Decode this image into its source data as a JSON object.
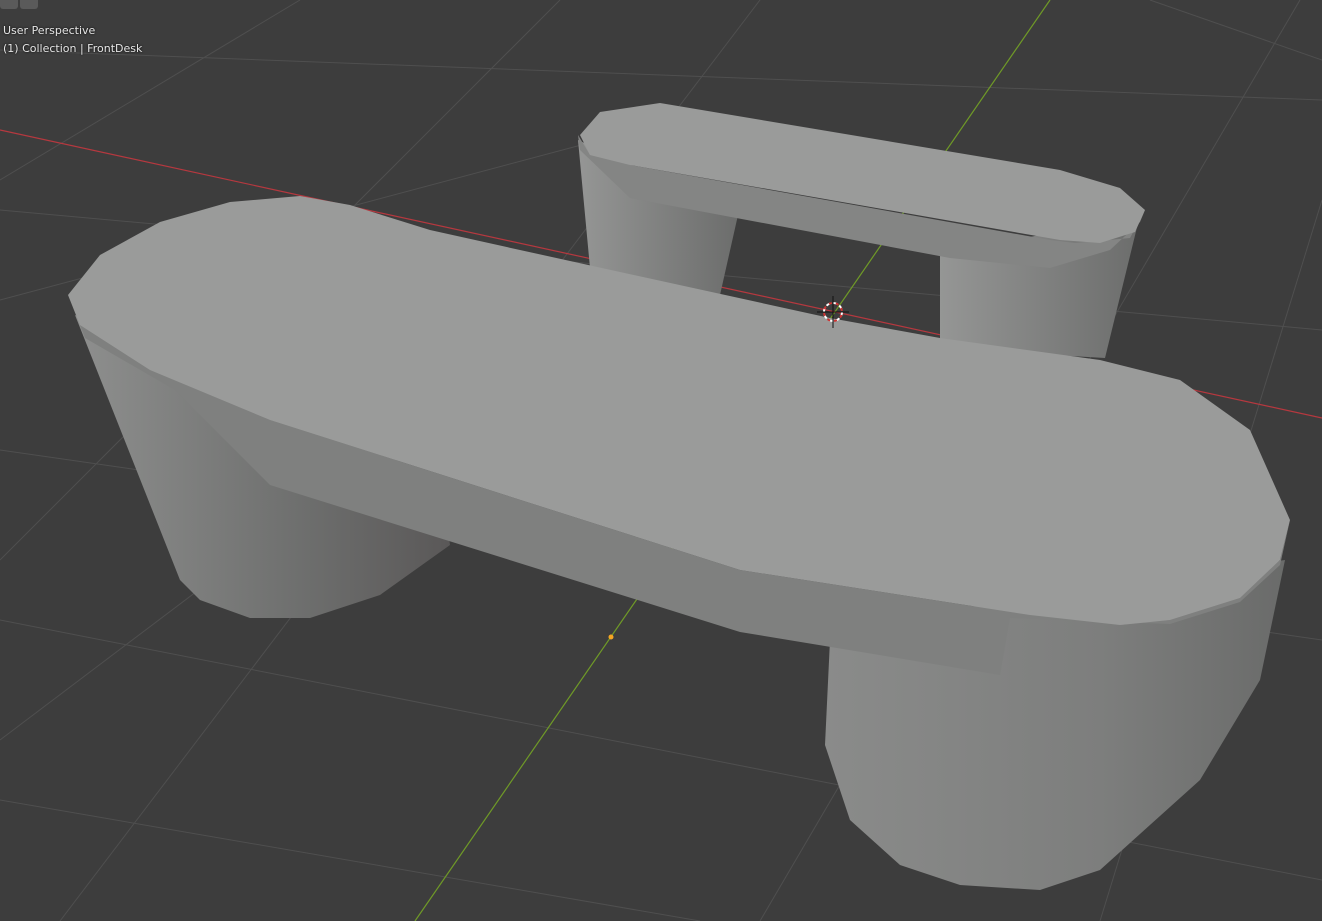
{
  "viewport": {
    "view_name": "User Perspective",
    "collection_label": "(1) Collection | FrontDesk",
    "icons": [
      "view-toggle-icon",
      "overlay-toggle-icon",
      "3d-cursor-icon",
      "origin-icon"
    ],
    "colors": {
      "background": "#3d3d3d",
      "x_axis": "#b6383f",
      "y_axis": "#6f9a27",
      "mesh": "#9a9b9a",
      "origin": "#f5a623"
    }
  }
}
